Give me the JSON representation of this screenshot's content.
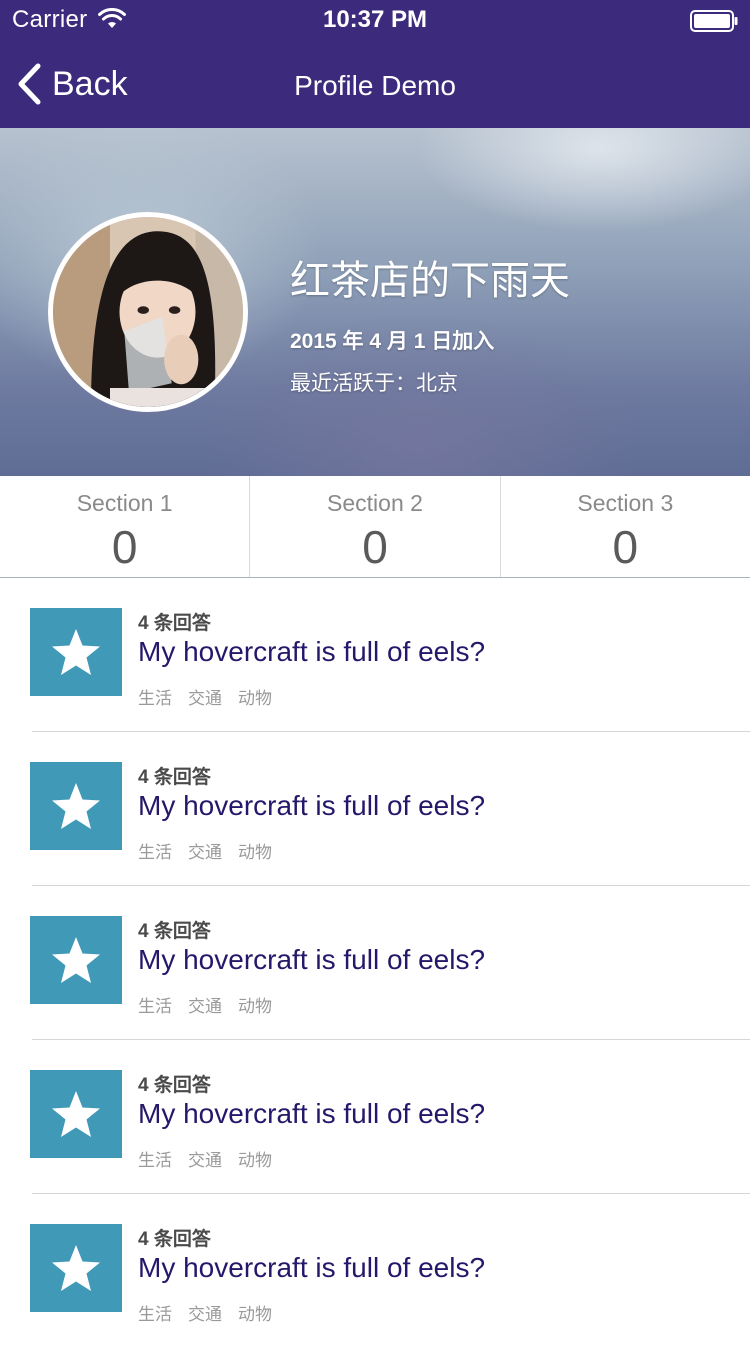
{
  "status_bar": {
    "carrier": "Carrier",
    "time": "10:37 PM",
    "wifi_icon": "wifi-icon",
    "battery_icon": "battery-icon"
  },
  "nav": {
    "back_label": "Back",
    "title": "Profile Demo",
    "back_icon": "chevron-left-icon"
  },
  "profile": {
    "name": "红茶店的下雨天",
    "joined": "2015 年 4 月 1 日加入",
    "last_active": "最近活跃于：北京"
  },
  "sections": [
    {
      "label": "Section 1",
      "value": "0"
    },
    {
      "label": "Section 2",
      "value": "0"
    },
    {
      "label": "Section 3",
      "value": "0"
    }
  ],
  "feed": [
    {
      "answers": "4 条回答",
      "question": "My hovercraft is full of eels?",
      "tags": [
        "生活",
        "交通",
        "动物"
      ]
    },
    {
      "answers": "4 条回答",
      "question": "My hovercraft is full of eels?",
      "tags": [
        "生活",
        "交通",
        "动物"
      ]
    },
    {
      "answers": "4 条回答",
      "question": "My hovercraft is full of eels?",
      "tags": [
        "生活",
        "交通",
        "动物"
      ]
    },
    {
      "answers": "4 条回答",
      "question": "My hovercraft is full of eels?",
      "tags": [
        "生活",
        "交通",
        "动物"
      ]
    },
    {
      "answers": "4 条回答",
      "question": "My hovercraft is full of eels?",
      "tags": [
        "生活",
        "交通",
        "动物"
      ]
    }
  ],
  "colors": {
    "nav_bg": "#3c2b7c",
    "thumb_bg": "#4199b8",
    "question_text": "#24186a"
  }
}
